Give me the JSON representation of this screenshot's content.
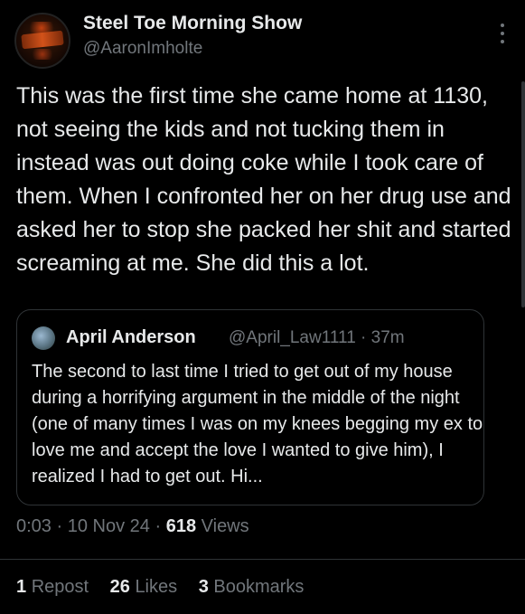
{
  "author": {
    "display_name": "Steel Toe Morning Show",
    "handle": "@AaronImholte",
    "avatar_icon": "steel-toe-logo"
  },
  "tweet": {
    "text": "This was the first time she came home at 1130, not seeing the kids and not tucking them in instead was out doing coke while I took care of them. When I confronted her on her drug use and asked her to stop she packed her shit and started screaming at me. She did this a lot."
  },
  "quote": {
    "name": "April Anderson",
    "handle": "@April_Law1111",
    "separator": "·",
    "time": "37m",
    "text": "The second to last time I tried to get out of my house during a horrifying argument in the middle of the night (one of many times I was on my knees begging my ex to love me and accept the love I wanted to give him), I realized I had to get out. Hi..."
  },
  "meta": {
    "time": "0:03",
    "separator": "·",
    "date": "10 Nov 24",
    "views_count": "618",
    "views_label": "Views"
  },
  "stats": {
    "reposts_count": "1",
    "reposts_label": "Repost",
    "likes_count": "26",
    "likes_label": "Likes",
    "bookmarks_count": "3",
    "bookmarks_label": "Bookmarks"
  },
  "colors": {
    "background": "#000000",
    "text": "#e7e9ea",
    "muted": "#71767b",
    "border": "#2f3336"
  }
}
